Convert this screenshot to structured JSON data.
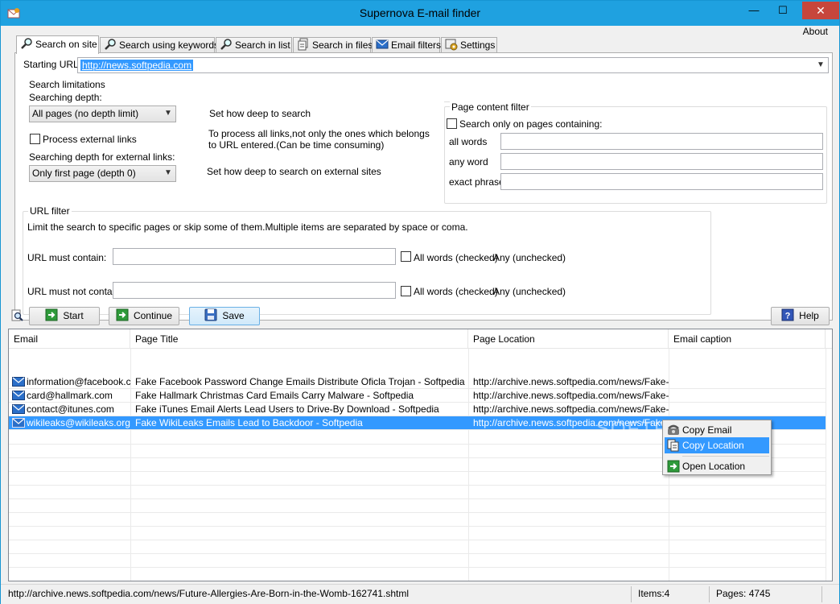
{
  "window": {
    "title": "Supernova E-mail finder",
    "controls": {
      "minimize": "—",
      "maximize": "☐",
      "close": "✕"
    }
  },
  "menu": {
    "about": "About"
  },
  "tabs": [
    {
      "label": "Search on site",
      "icon": "magnifier-icon",
      "active": true
    },
    {
      "label": "Search using keywords",
      "icon": "magnifier-icon"
    },
    {
      "label": "Search in list",
      "icon": "magnifier-icon"
    },
    {
      "label": "Search in files",
      "icon": "files-icon"
    },
    {
      "label": "Email filters",
      "icon": "envelope-icon"
    },
    {
      "label": "Settings",
      "icon": "settings-icon"
    }
  ],
  "search_on_site": {
    "starting_url_label": "Starting URL:",
    "starting_url_value": "http://news.softpedia.com",
    "search_limitations": {
      "title": "Search limitations",
      "depth_label": "Searching depth:",
      "depth_value": "All pages (no depth limit)",
      "depth_hint": "Set how deep to search",
      "external_links_label": "Process external links",
      "external_links_checked": false,
      "external_links_hint_1": "To process all links,not only the ones which belongs",
      "external_links_hint_2": "to URL entered.(Can be time consuming)",
      "ext_depth_label": "Searching depth for external links:",
      "ext_depth_value": "Only first page (depth 0)",
      "ext_depth_hint": "Set how deep to search on external sites"
    },
    "page_content_filter": {
      "title": "Page content filter",
      "only_pages_label": "Search only on pages containing:",
      "only_pages_checked": false,
      "all_words_label": "all words",
      "any_word_label": "any word",
      "exact_phrase_label": "exact phrase",
      "all_words_value": "",
      "any_word_value": "",
      "exact_phrase_value": ""
    },
    "url_filter": {
      "title": "URL filter",
      "description": "Limit the search to specific pages or skip some of them.Multiple items are separated by space or coma.",
      "must_contain_label": "URL must contain:",
      "must_contain_value": "",
      "must_not_contain_label": "URL must not contain:",
      "must_not_contain_value": "",
      "all_words_checked_label": "All words (checked)",
      "any_unchecked_label": "Any (unchecked)"
    }
  },
  "toolbar": {
    "start_label": "Start",
    "continue_label": "Continue",
    "save_label": "Save",
    "help_label": "Help"
  },
  "results": {
    "columns": [
      "Email",
      "Page Title",
      "Page Location",
      "Email caption"
    ],
    "rows": [
      {
        "email": "information@facebook.c...",
        "title": "Fake Facebook Password Change Emails Distribute Oficla Trojan - Softpedia",
        "location": "http://archive.news.softpedia.com/news/Fake-...",
        "caption": ""
      },
      {
        "email": "card@hallmark.com",
        "title": "Fake Hallmark Christmas Card Emails Carry Malware - Softpedia",
        "location": "http://archive.news.softpedia.com/news/Fake-...",
        "caption": ""
      },
      {
        "email": "contact@itunes.com",
        "title": "Fake iTunes Email Alerts Lead Users to Drive-By Download - Softpedia",
        "location": "http://archive.news.softpedia.com/news/Fake-i...",
        "caption": ""
      },
      {
        "email": "wikileaks@wikileaks.org",
        "title": "Fake WikiLeaks Emails Lead to Backdoor - Softpedia",
        "location": "http://archive.news.softpedia.com/news/Fake-...",
        "caption": "",
        "selected": true
      }
    ]
  },
  "context_menu": {
    "items": [
      "Copy Email",
      "Copy Location",
      "Open Location"
    ],
    "highlighted": "Copy Location"
  },
  "status_bar": {
    "url": "http://archive.news.softpedia.com/news/Future-Allergies-Are-Born-in-the-Womb-162741.shtml",
    "items": "Items:4",
    "pages": "Pages: 4745"
  },
  "colors": {
    "titlebar": "#1fa1e0",
    "selection": "#3399ff",
    "close_button": "#c7463c"
  }
}
